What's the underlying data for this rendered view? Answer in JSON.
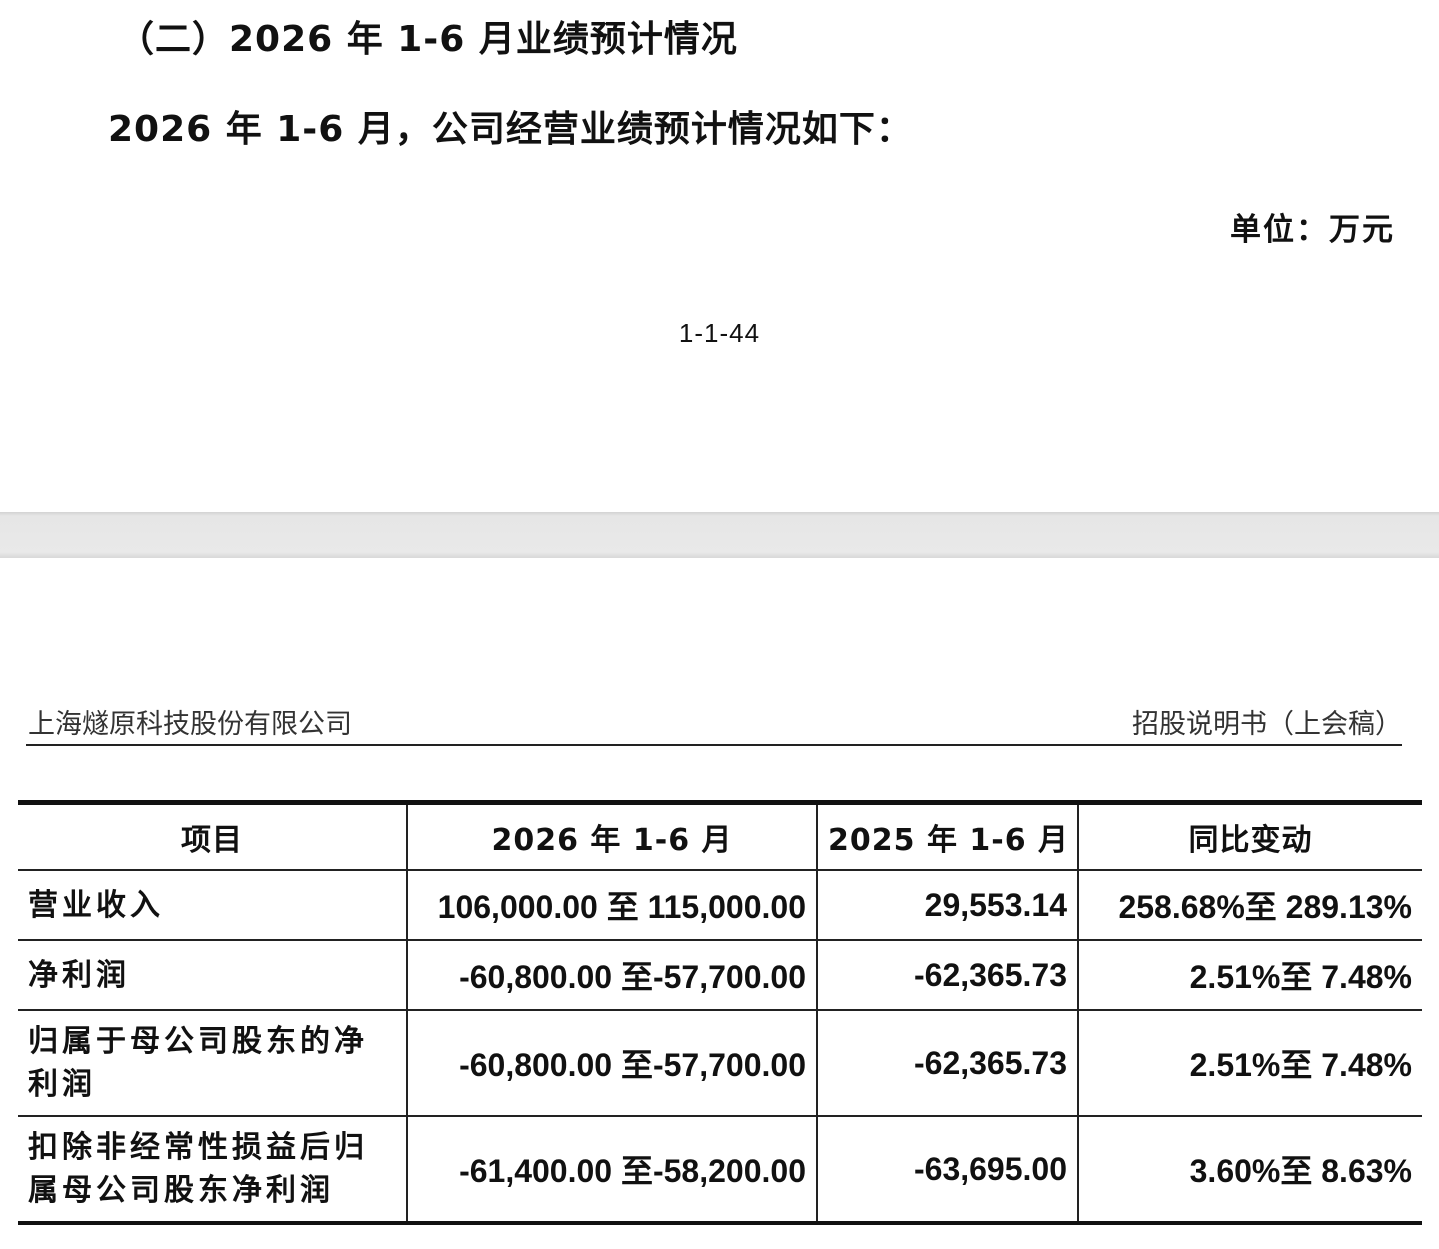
{
  "page1": {
    "section_heading": "（二）2026 年 1-6 月业绩预计情况",
    "intro": "2026 年 1-6 月，公司经营业绩预计情况如下：",
    "unit": "单位：万元",
    "page_number": "1-1-44"
  },
  "page2": {
    "header_left": "上海燧原科技股份有限公司",
    "header_right": "招股说明书（上会稿）"
  },
  "table": {
    "headers": [
      "项目",
      "2026 年 1-6 月",
      "2025 年 1-6 月",
      "同比变动"
    ],
    "rows": [
      [
        "营业收入",
        "106,000.00 至 115,000.00",
        "29,553.14",
        "258.68%至 289.13%"
      ],
      [
        "净利润",
        "-60,800.00 至-57,700.00",
        "-62,365.73",
        "2.51%至 7.48%"
      ],
      [
        "归属于母公司股东的净利润",
        "-60,800.00 至-57,700.00",
        "-62,365.73",
        "2.51%至 7.48%"
      ],
      [
        "扣除非经常性损益后归属母公司股东净利润",
        "-61,400.00 至-58,200.00",
        "-63,695.00",
        "3.60%至 8.63%"
      ]
    ]
  }
}
